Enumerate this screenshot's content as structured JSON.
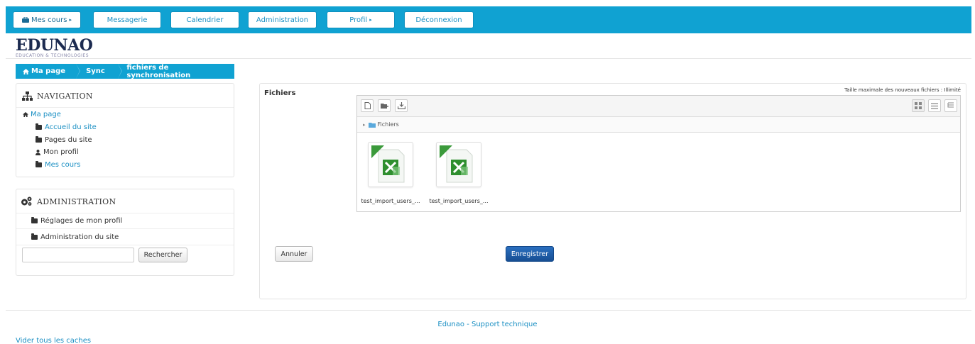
{
  "topnav": {
    "mes_cours": "Mes cours",
    "messagerie": "Messagerie",
    "calendrier": "Calendrier",
    "administration": "Administration",
    "profil": "Profil",
    "deconnexion": "Déconnexion"
  },
  "logo": {
    "name": "EDUNAO",
    "tagline": "EDUCATION & TECHNOLOGIES"
  },
  "breadcrumb": [
    "Ma page",
    "Sync",
    "fichiers de synchronisation"
  ],
  "navigation": {
    "title": "NAVIGATION",
    "ma_page": "Ma page",
    "items": [
      "Accueil du site",
      "Pages du site",
      "Mon profil",
      "Mes cours"
    ]
  },
  "administration": {
    "title": "ADMINISTRATION",
    "items": [
      "Réglages de mon profil",
      "Administration du site"
    ],
    "search_value": "",
    "search_button": "Rechercher"
  },
  "form": {
    "label": "Fichiers",
    "max_size": "Taille maximale des nouveaux fichiers : Illimité",
    "path_label": "Fichiers",
    "files": [
      "test_import_users_...",
      "test_import_users_..."
    ],
    "cancel": "Annuler",
    "save": "Enregistrer"
  },
  "footer": {
    "support": "Edunao - Support technique",
    "caches": "Vider tous les caches"
  },
  "colors": {
    "brand": "#10a2d2",
    "primary_button": "#1f5fa8"
  }
}
